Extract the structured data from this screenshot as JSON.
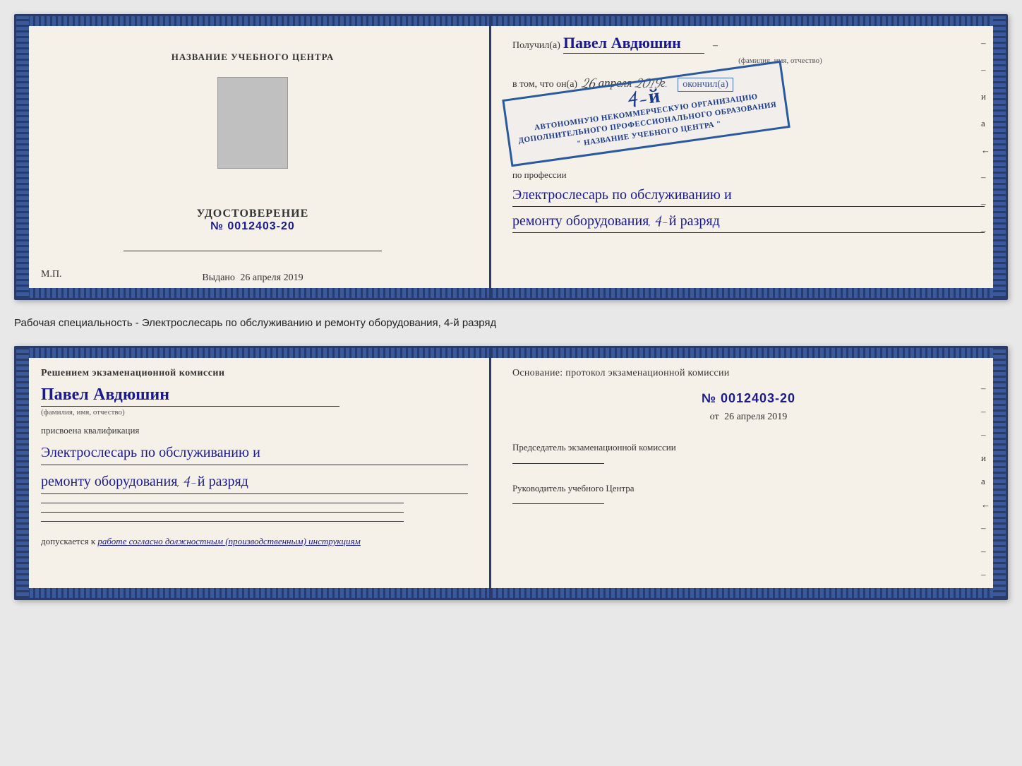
{
  "topDoc": {
    "leftPage": {
      "centerTitle": "НАЗВАНИЕ УЧЕБНОГО ЦЕНТРА",
      "certTitle": "УДОСТОВЕРЕНИЕ",
      "certNumber": "№ 0012403-20",
      "issuedLine": "Выдано",
      "issuedDate": "26 апреля 2019",
      "mpLabel": "М.П."
    },
    "rightPage": {
      "receivedLabel": "Получил(а)",
      "recipientName": "Павел Авдюшин",
      "fioSubtitle": "(фамилия, имя, отчество)",
      "vtomLabel": "в том, что он(а)",
      "vtomDate": "26 апреля 2019г.",
      "finishedLabel": "окончил(а)",
      "stampLine1": "АВТОНОМНУЮ НЕКОММЕРЧЕСКУЮ ОРГАНИЗАЦИЮ",
      "stampLine2": "ДОПОЛНИТЕЛЬНОГО ПРОФЕССИОНАЛЬНОГО ОБРАЗОВАНИЯ",
      "stampLine3": "\" НАЗВАНИЕ УЧЕБНОГО ЦЕНТРА \"",
      "stampGrade": "4-й",
      "professionLabel": "по профессии",
      "professionText1": "Электрослесарь по обслуживанию и",
      "professionText2": "ремонту оборудования, 4-й разряд"
    },
    "rightMarks": [
      "-",
      "–",
      "и",
      "а",
      "←",
      "–",
      "–",
      "–"
    ]
  },
  "separatorText": "Рабочая специальность - Электрослесарь по обслуживанию и ремонту оборудования, 4-й разряд",
  "bottomDoc": {
    "leftPage": {
      "examTitle": "Решением экзаменационной комиссии",
      "personName": "Павел Авдюшин",
      "fioSubtitle": "(фамилия, имя, отчество)",
      "assignedLabel": "присвоена квалификация",
      "qualText1": "Электрослесарь по обслуживанию и",
      "qualText2": "ремонту оборудования, 4-й разряд",
      "allowedLabel": "допускается к",
      "allowedText": "работе согласно должностным (производственным) инструкциям"
    },
    "rightPage": {
      "basisLabel": "Основание: протокол экзаменационной комиссии",
      "protocolNumber": "№ 0012403-20",
      "datePrefix": "от",
      "protocolDate": "26 апреля 2019",
      "chairmanLabel": "Председатель экзаменационной комиссии",
      "directorLabel": "Руководитель учебного Центра"
    },
    "rightMarks": [
      "–",
      "–",
      "–",
      "и",
      "а",
      "←",
      "–",
      "–",
      "–"
    ]
  }
}
